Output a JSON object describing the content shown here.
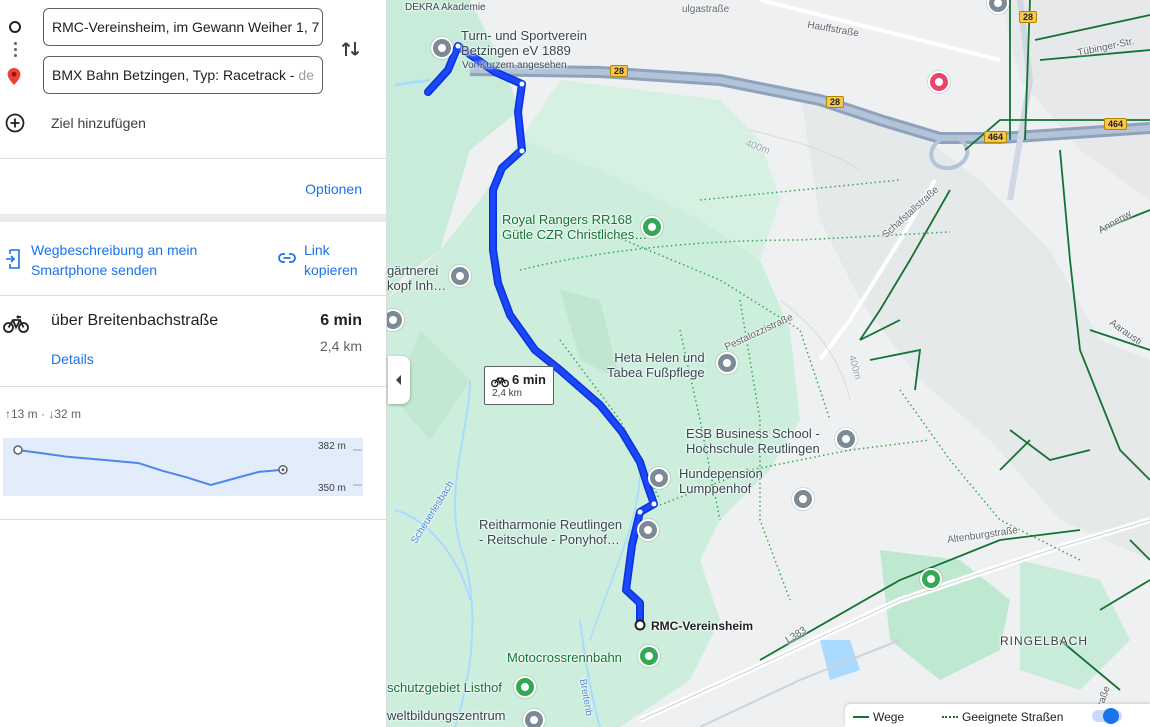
{
  "panel": {
    "origin_value": "RMC-Vereinsheim, im Gewann Weiher 1, 7",
    "destination_value_main": "BMX Bahn Betzingen, Typ: Racetrack - ",
    "destination_value_faded": "de",
    "add_destination": "Ziel hinzufügen",
    "options": "Optionen",
    "send_to_phone_line1": "Wegbeschreibung an mein",
    "send_to_phone_line2": "Smartphone senden",
    "copy_link_line1": "Link",
    "copy_link_line2": "kopieren",
    "route": {
      "via": "über Breitenbachstraße",
      "duration": "6 min",
      "distance": "2,4 km",
      "details": "Details"
    },
    "elevation": {
      "ascent": "13 m",
      "descent": "32 m",
      "max_label": "382 m",
      "min_label": "350 m",
      "profile": [
        382,
        379,
        376,
        374,
        372,
        370,
        363,
        357,
        350,
        356,
        362,
        364
      ]
    }
  },
  "map": {
    "route_bubble": {
      "duration": "6 min",
      "distance": "2,4 km"
    },
    "labels": {
      "dekra": "DEKRA Akademie",
      "turn_1": "Turn- und Sportverein",
      "turn_2": "Betzingen eV 1889",
      "recent": "Vor Kurzem angesehen",
      "hauffstrasse": "Hauffstraße",
      "ulgastrasse": "ulgastraße",
      "tuebinger": "Tübinger-Str.",
      "royal_1": "Royal Rangers RR168",
      "royal_2": "Gütle CZR Christliches…",
      "gaertnerei_1": "gärtnerei",
      "gaertnerei_2": "kopf Inh…",
      "schafstall": "Schafstallstraße",
      "annenweg": "Annenw",
      "pestalozzi": "Pestalozzistraße",
      "aarau": "Aarausti",
      "heta_1": "Heta Helen und",
      "heta_2": "Tabea Fußpflege",
      "esb_1": "ESB Business School -",
      "esb_2": "Hochschule Reutlingen",
      "hund_1": "Hundepension",
      "hund_2": "Lumppenhof",
      "reit_1": "Reitharmonie Reutlingen",
      "reit_2": "- Reitschule -  Ponyhof…",
      "scheuerle": "Scheuerlesbach",
      "rmc": "RMC-Vereinsheim",
      "motocross": "Motocrossrennbahn",
      "schutz": "schutzgebiet Listhof",
      "welt": "weltbildungszentrum",
      "breiten": "Breitenb",
      "altenburg": "Altenburgstraße",
      "ringelbach": "RINGELBACH",
      "l383": "L383",
      "strasse_sb": "traße",
      "elev_400a": "400m",
      "elev_400b": "400m"
    },
    "shields": {
      "b28a": "28",
      "b28b": "28",
      "b28c": "28",
      "b464a": "464",
      "b464b": "464"
    },
    "legend": {
      "paths": "Wege",
      "suitable": "Geeignete Straßen"
    },
    "colors": {
      "route": "#1a47ff",
      "park": "#c8ecd9",
      "water": "#aadaff",
      "bike_path": "#137333"
    }
  }
}
